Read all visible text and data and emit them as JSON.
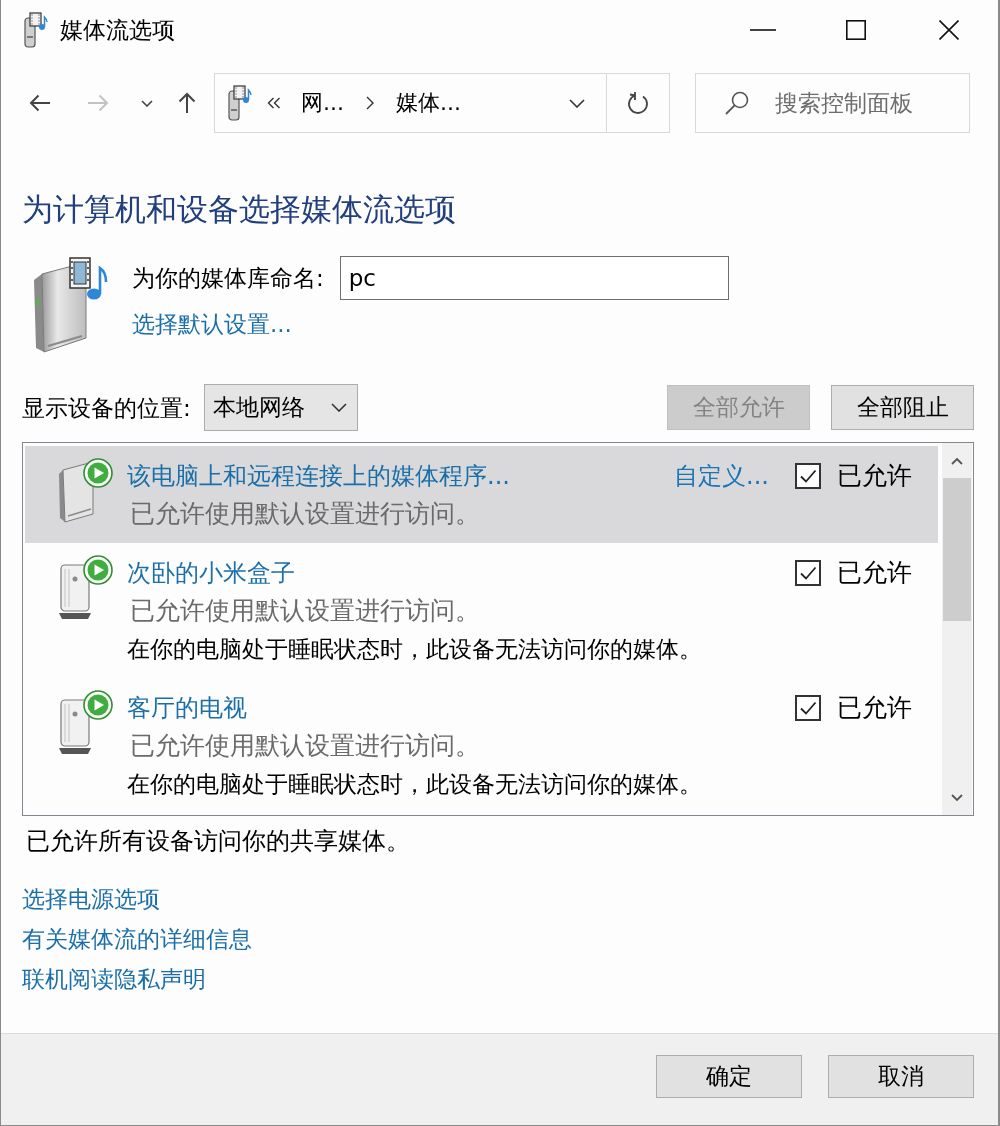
{
  "window": {
    "title": "媒体流选项"
  },
  "nav_buttons": [
    {
      "kind": "back",
      "disabled": false
    },
    {
      "kind": "forward",
      "disabled": true
    },
    {
      "kind": "recent",
      "disabled": false
    },
    {
      "kind": "up",
      "disabled": false
    }
  ],
  "address_bar": {
    "crumbs": [
      "网...",
      "媒体..."
    ]
  },
  "search": {
    "placeholder": "搜索控制面板"
  },
  "heading": "为计算机和设备选择媒体流选项",
  "library": {
    "label": "为你的媒体库命名:",
    "value": "pc",
    "link": "选择默认设置..."
  },
  "location": {
    "label": "显示设备的位置:",
    "value": "本地网络"
  },
  "actions": [
    {
      "label": "全部允许",
      "disabled": true
    },
    {
      "label": "全部阻止",
      "disabled": false
    }
  ],
  "devices": [
    {
      "kind": "computer",
      "name": "该电脑上和远程连接上的媒体程序...",
      "status": "已允许使用默认设置进行访问。",
      "customize": "自定义...",
      "checked": true,
      "check_label": "已允许",
      "selected": true
    },
    {
      "kind": "device",
      "name": "次卧的小米盒子",
      "status": "已允许使用默认设置进行访问。",
      "note": "在你的电脑处于睡眠状态时，此设备无法访问你的媒体。",
      "checked": true,
      "check_label": "已允许",
      "selected": false
    },
    {
      "kind": "device",
      "name": "客厅的电视",
      "status": "已允许使用默认设置进行访问。",
      "note": "在你的电脑处于睡眠状态时，此设备无法访问你的媒体。",
      "checked": true,
      "check_label": "已允许",
      "selected": false
    }
  ],
  "summary": "已允许所有设备访问你的共享媒体。",
  "links": [
    "选择电源选项",
    "有关媒体流的详细信息",
    "联机阅读隐私声明"
  ],
  "dialog_buttons": [
    "确定",
    "取消"
  ]
}
